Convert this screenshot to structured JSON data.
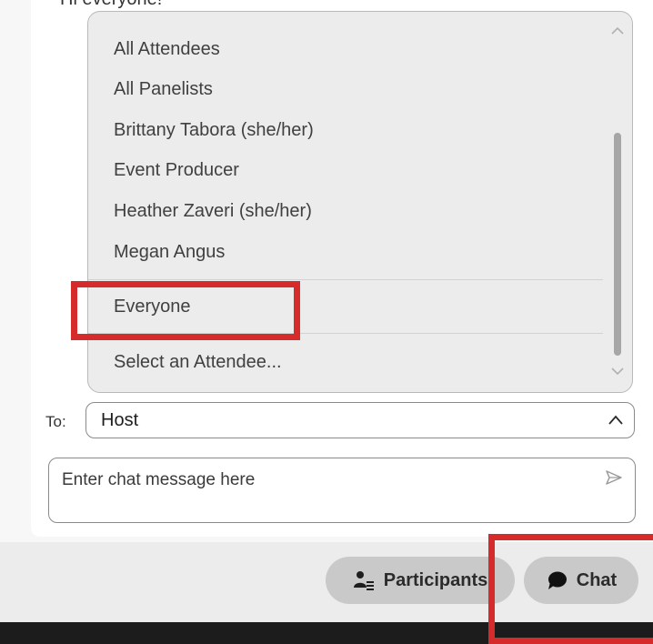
{
  "chat": {
    "message_cut": "Hi everyone!"
  },
  "dropdown": {
    "items": [
      "All Attendees",
      "All Panelists",
      "Brittany Tabora (she/her)",
      "Event Producer",
      "Heather Zaveri (she/her)",
      "Megan Angus",
      "Everyone",
      "Select an Attendee..."
    ]
  },
  "to_row": {
    "label": "To:",
    "selected": "Host"
  },
  "input": {
    "placeholder": "Enter chat message here"
  },
  "bottom_bar": {
    "participants_label": "Participants",
    "chat_label": "Chat"
  },
  "icons": {
    "scroll_up": "chevron-up-icon",
    "scroll_down": "chevron-down-icon",
    "select_toggle": "chevron-up-icon",
    "send": "send-icon",
    "participants": "participants-icon",
    "chat": "chat-bubble-icon"
  },
  "colors": {
    "highlight": "#d62b2b",
    "button_bg": "#c9c9c9",
    "dropdown_bg": "#ececec"
  }
}
